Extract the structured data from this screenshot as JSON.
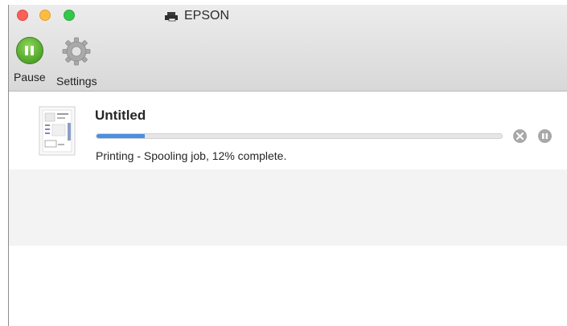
{
  "window": {
    "title": "EPSON",
    "title_icon": "printer-icon"
  },
  "toolbar": {
    "pause_label": "Pause",
    "pause_icon": "pause-icon",
    "settings_label": "Settings",
    "settings_icon": "gear-icon"
  },
  "job": {
    "name": "Untitled",
    "progress_percent": 12,
    "status": "Printing - Spooling job, 12% complete.",
    "thumbnail_icon": "document-icon",
    "cancel_icon": "cancel-icon",
    "pause_icon": "pause-job-icon"
  },
  "colors": {
    "progress_fill": "#4a90e2",
    "pause_button": "#4fa52a"
  }
}
